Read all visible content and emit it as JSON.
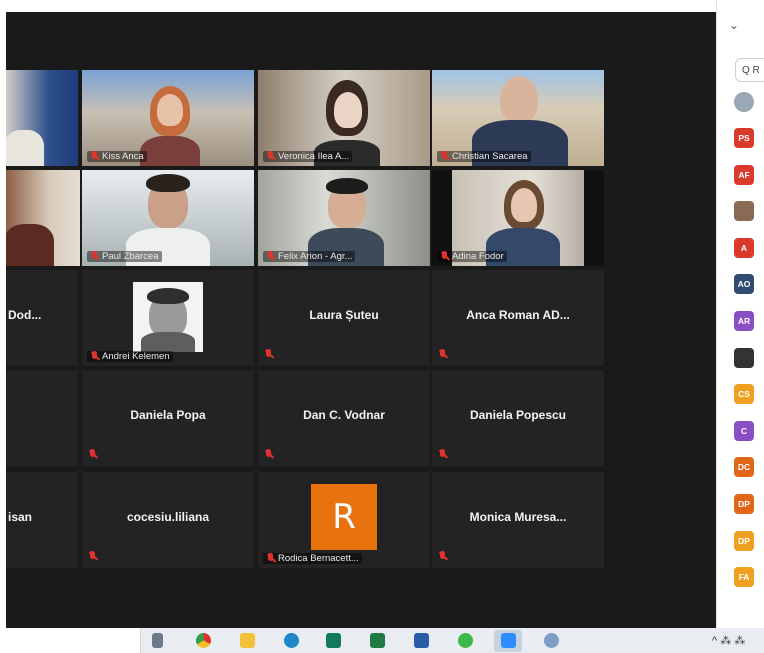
{
  "gallery": {
    "row1": {
      "t2": "Kiss Anca",
      "t3": "Veronica Ilea A...",
      "t4": "Christian Sacarea"
    },
    "row2": {
      "t2": "Paul Zbarcea",
      "t3": "Felix Arion - Agr...",
      "t4": "Adina Fodor"
    },
    "row3": {
      "t1": "Dod...",
      "t2": "Andrei Kelemen",
      "t3": "Laura Șuteu",
      "t4": "Anca Roman AD..."
    },
    "row4": {
      "t2": "Daniela Popa",
      "t3": "Dan C. Vodnar",
      "t4": "Daniela Popescu"
    },
    "row5": {
      "t1": "isan",
      "t2": "cocesiu.liliana",
      "t3": "Rodica Bernacett...",
      "t3_initial": "R",
      "t4": "Monica  Muresa..."
    }
  },
  "panel": {
    "chevron": "⌄",
    "search_text": "Q R",
    "avatars": [
      {
        "initials": "PS",
        "color": "#d93a2c"
      },
      {
        "initials": "AF",
        "color": "#d93a2c"
      },
      {
        "initials": "",
        "color": "#8a6a55"
      },
      {
        "initials": "A",
        "color": "#d93a2c"
      },
      {
        "initials": "AO",
        "color": "#2f4d6f"
      },
      {
        "initials": "AR",
        "color": "#8a4fc4"
      },
      {
        "initials": "",
        "color": "#333333"
      },
      {
        "initials": "CS",
        "color": "#f0a020"
      },
      {
        "initials": "C",
        "color": "#8a4fc4"
      },
      {
        "initials": "DC",
        "color": "#e0661a"
      },
      {
        "initials": "DP",
        "color": "#e0661a"
      },
      {
        "initials": "DP",
        "color": "#f0a020"
      },
      {
        "initials": "FA",
        "color": "#f0a020"
      }
    ]
  },
  "taskbar": {
    "tray_text": "^ ⁂ ⁂"
  }
}
